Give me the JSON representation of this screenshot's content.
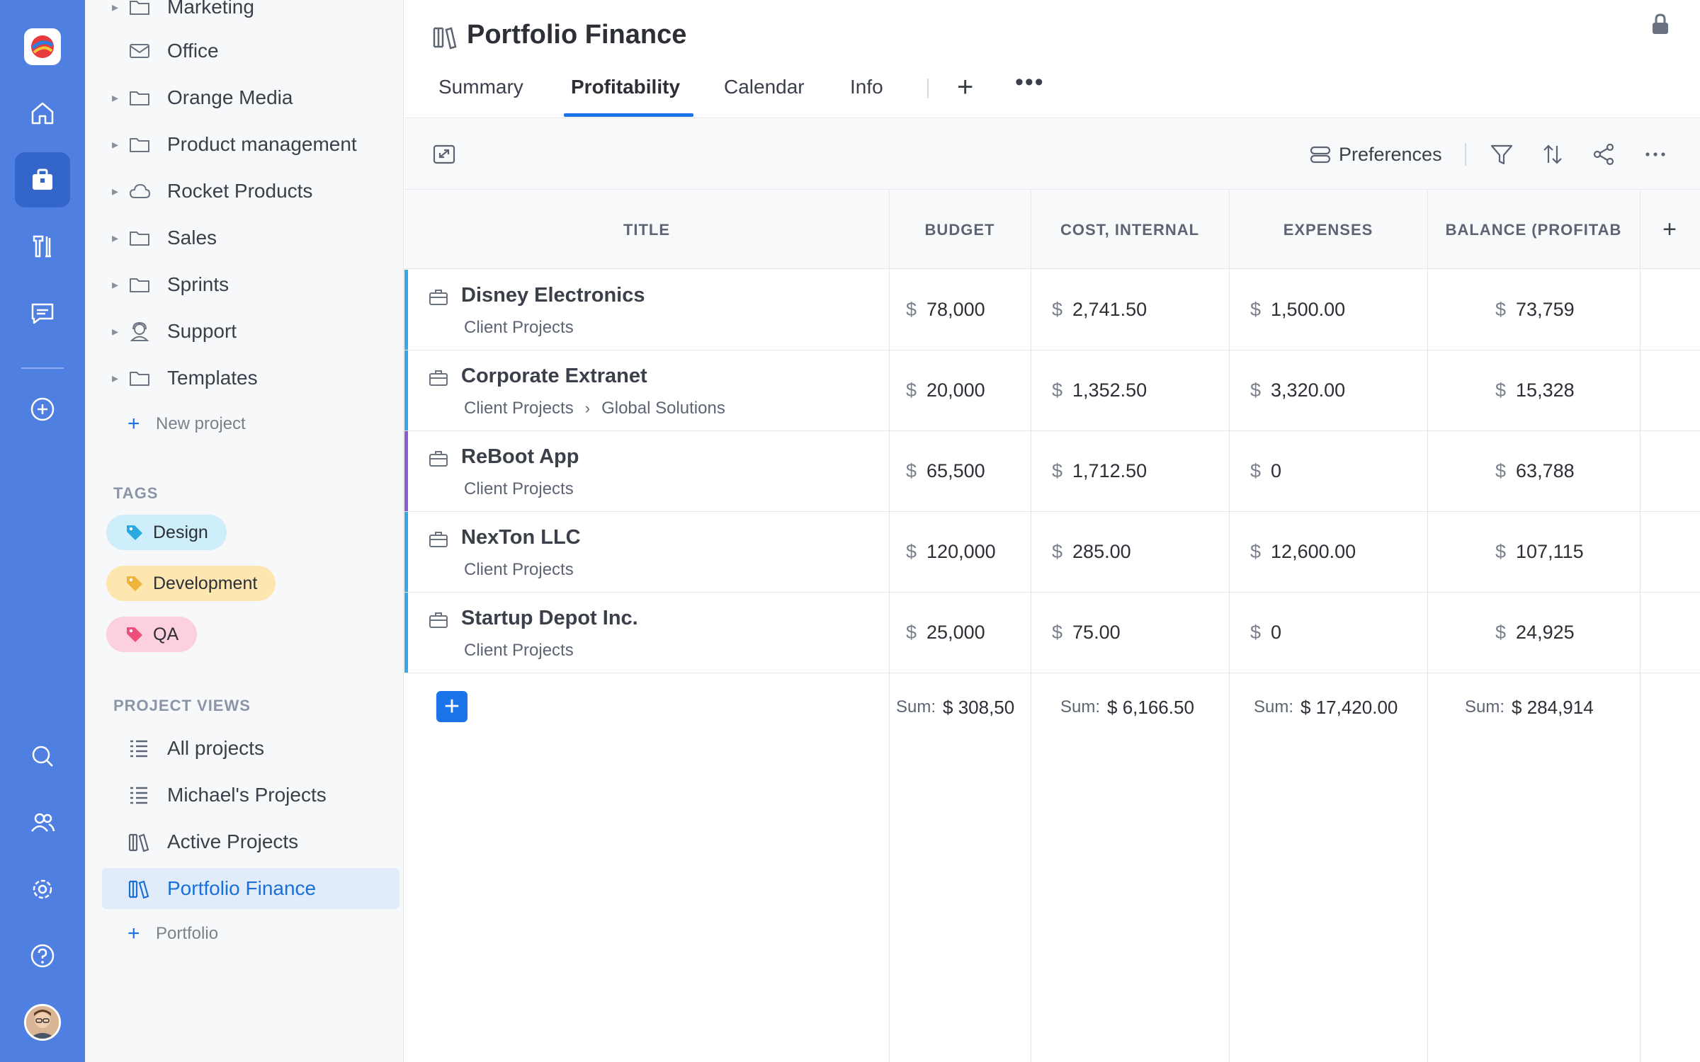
{
  "app": {
    "page_title": "Portfolio Finance"
  },
  "colors": {
    "rail": "#4f7fe0",
    "accent": "#1a73e8",
    "stripe_blue": "#35a9e6",
    "stripe_purple": "#8a5cd6"
  },
  "rail": {
    "items": [
      "home-icon",
      "briefcase-icon",
      "tools-icon",
      "chat-icon",
      "add-circle-icon",
      "search-icon",
      "users-icon",
      "settings-icon",
      "help-icon"
    ]
  },
  "sidebar": {
    "top_partial_label": "Marketing",
    "tree": [
      {
        "label": "Office",
        "icon": "mail-icon",
        "caret": false
      },
      {
        "label": "Orange Media",
        "icon": "folder-icon",
        "caret": true
      },
      {
        "label": "Product management",
        "icon": "folder-icon",
        "caret": true
      },
      {
        "label": "Rocket Products",
        "icon": "cloud-icon",
        "caret": true
      },
      {
        "label": "Sales",
        "icon": "folder-icon",
        "caret": true
      },
      {
        "label": "Sprints",
        "icon": "folder-icon",
        "caret": true
      },
      {
        "label": "Support",
        "icon": "support-icon",
        "caret": true
      },
      {
        "label": "Templates",
        "icon": "folder-icon",
        "caret": true
      }
    ],
    "new_project_label": "New project",
    "tags_title": "TAGS",
    "tags": [
      {
        "label": "Design",
        "bg": "#cfeefb",
        "color": "#2aa9e0"
      },
      {
        "label": "Development",
        "bg": "#fde6b0",
        "color": "#f0b43c"
      },
      {
        "label": "QA",
        "bg": "#fcd0de",
        "color": "#ee4f7c"
      }
    ],
    "views_title": "PROJECT VIEWS",
    "views": [
      {
        "label": "All projects",
        "icon": "list-icon",
        "active": false
      },
      {
        "label": "Michael's Projects",
        "icon": "list-icon",
        "active": false
      },
      {
        "label": "Active Projects",
        "icon": "portfolio-icon",
        "active": false
      },
      {
        "label": "Portfolio Finance",
        "icon": "portfolio-icon",
        "active": true
      }
    ],
    "add_portfolio_label": "Portfolio"
  },
  "tabs": [
    {
      "label": "Summary",
      "active": false
    },
    {
      "label": "Profitability",
      "active": true
    },
    {
      "label": "Calendar",
      "active": false
    },
    {
      "label": "Info",
      "active": false
    }
  ],
  "toolbar": {
    "preferences_label": "Preferences"
  },
  "table": {
    "columns": [
      "TITLE",
      "BUDGET",
      "COST, INTERNAL",
      "EXPENSES",
      "BALANCE (PROFITAB"
    ],
    "currency": "$",
    "rows": [
      {
        "title": "Disney Electronics",
        "path": [
          "Client Projects"
        ],
        "stripe": "#35a9e6",
        "budget": "78,000",
        "cost": "2,741.50",
        "expenses": "1,500.00",
        "balance": "73,759"
      },
      {
        "title": "Corporate Extranet",
        "path": [
          "Client Projects",
          "Global Solutions"
        ],
        "stripe": "#35a9e6",
        "budget": "20,000",
        "cost": "1,352.50",
        "expenses": "3,320.00",
        "balance": "15,328"
      },
      {
        "title": "ReBoot App",
        "path": [
          "Client Projects"
        ],
        "stripe": "#8a5cd6",
        "budget": "65,500",
        "cost": "1,712.50",
        "expenses": "0",
        "balance": "63,788"
      },
      {
        "title": "NexTon LLC",
        "path": [
          "Client Projects"
        ],
        "stripe": "#35a9e6",
        "budget": "120,000",
        "cost": "285.00",
        "expenses": "12,600.00",
        "balance": "107,115"
      },
      {
        "title": "Startup Depot Inc.",
        "path": [
          "Client Projects"
        ],
        "stripe": "#35a9e6",
        "budget": "25,000",
        "cost": "75.00",
        "expenses": "0",
        "balance": "24,925"
      }
    ],
    "sum_label": "Sum:",
    "sums": {
      "budget": "$ 308,50",
      "cost": "$ 6,166.50",
      "expenses": "$ 17,420.00",
      "balance": "$ 284,914"
    }
  }
}
